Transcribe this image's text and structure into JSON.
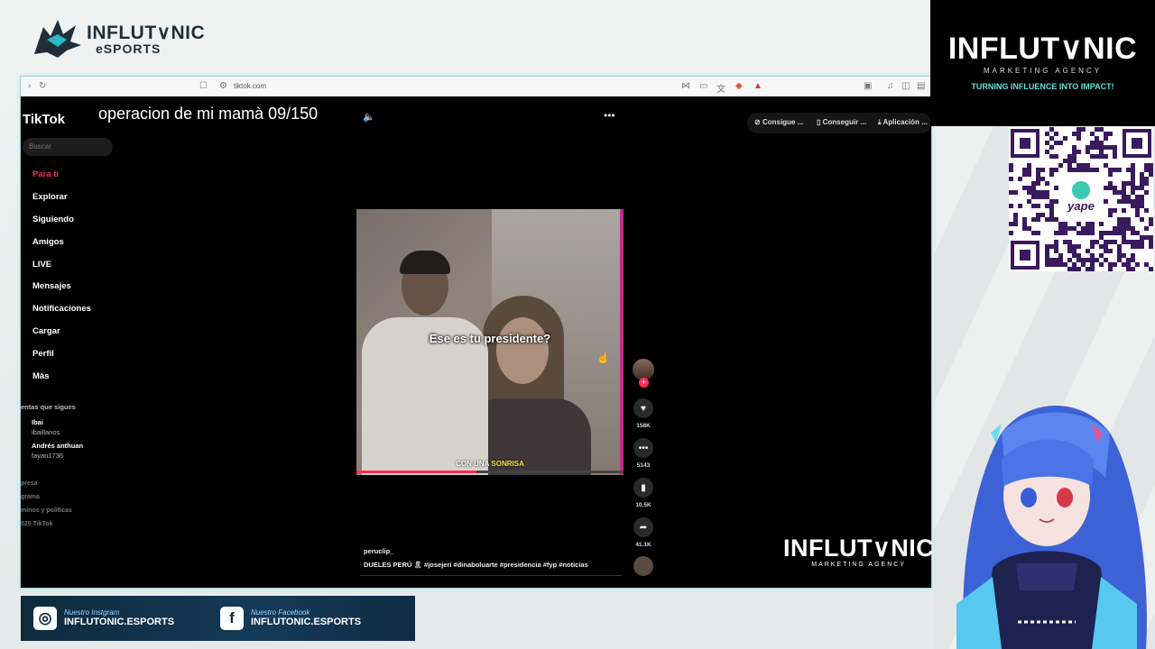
{
  "brand": {
    "top_left_line1": "INFLUT∨NIC",
    "top_left_line2": "eSPORTS",
    "right_name": "INFLUT∨NIC",
    "right_sub": "MARKETING AGENCY",
    "right_tagline": "TURNING INFLUENCE INTO IMPACT!",
    "watermark_name": "INFLUT∨NIC",
    "watermark_sub": "MARKETING AGENCY"
  },
  "browser": {
    "url": "tiktok.com"
  },
  "tiktok": {
    "logo": "TikTok",
    "stream_title": "operacion de mi mamà 09/150",
    "search_placeholder": "Buscar",
    "top_buttons": [
      "Consigue ...",
      "Conseguir ...",
      "Aplicación ..."
    ],
    "nav": [
      {
        "label": "Para ti",
        "active": true
      },
      {
        "label": "Explorar"
      },
      {
        "label": "Siguiendo"
      },
      {
        "label": "Amigos"
      },
      {
        "label": "LIVE"
      },
      {
        "label": "Mensajes"
      },
      {
        "label": "Notificaciones"
      },
      {
        "label": "Cargar"
      },
      {
        "label": "Perfil"
      },
      {
        "label": "Más"
      }
    ],
    "following_header": "entas que sigues",
    "following": [
      {
        "name": "Ibai",
        "handle": "ibaillanos"
      },
      {
        "name": "Andrés anthuan",
        "handle": "fayan1736"
      }
    ],
    "footer": [
      "presa",
      "grama",
      "minos y políticas",
      "025 TikTok"
    ],
    "video": {
      "caption": "Ese es tu presidente?",
      "subcaption_white": "CON UNA",
      "subcaption_yellow": "SONRISA",
      "progress": 0.45,
      "user": "peruclip_",
      "description": "DUELES PERÚ 🎗 #josejeri #dinaboluarte #presidencia #fyp #noticias"
    },
    "actions": [
      {
        "icon": "heart-icon",
        "count": "158K"
      },
      {
        "icon": "comment-icon",
        "count": "5143"
      },
      {
        "icon": "bookmark-icon",
        "count": "10.5K"
      },
      {
        "icon": "share-icon",
        "count": "41.1K"
      }
    ]
  },
  "social": {
    "instagram_small": "Nuestro Instgram",
    "instagram_main": "INFLUTONIC.ESPORTS",
    "facebook_small": "Nuestro Facebook",
    "facebook_main": "INFLUTONIC.ESPORTS"
  },
  "colors": {
    "accent": "#fe2c55",
    "brand_teal": "#66e0d7",
    "social_bg": "#143a58"
  }
}
